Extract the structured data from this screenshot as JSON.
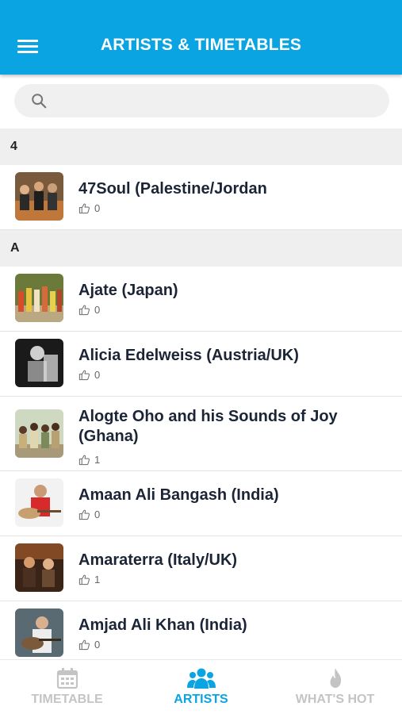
{
  "header": {
    "title": "ARTISTS & TIMETABLES",
    "menu_icon": "hamburger-menu-icon",
    "background": "#0aa4e3"
  },
  "search": {
    "placeholder": "",
    "value": "",
    "icon": "search-icon"
  },
  "sections": [
    {
      "letter": "4",
      "artists": [
        {
          "name": "47Soul (Palestine/Jordan",
          "likes": "0"
        }
      ]
    },
    {
      "letter": "A",
      "artists": [
        {
          "name": "Ajate (Japan)",
          "likes": "0"
        },
        {
          "name": "Alicia Edelweiss (Austria/UK)",
          "likes": "0"
        },
        {
          "name": "Alogte Oho and his Sounds of Joy (Ghana)",
          "likes": "1"
        },
        {
          "name": "Amaan Ali Bangash (India)",
          "likes": "0"
        },
        {
          "name": "Amaraterra (Italy/UK)",
          "likes": "1"
        },
        {
          "name": "Amjad Ali Khan (India)",
          "likes": "0"
        }
      ]
    }
  ],
  "tabs": [
    {
      "label": "TIMETABLE",
      "icon": "calendar-icon",
      "active": false
    },
    {
      "label": "ARTISTS",
      "icon": "group-icon",
      "active": true
    },
    {
      "label": "WHAT'S HOT",
      "icon": "flame-icon",
      "active": false
    }
  ],
  "colors": {
    "accent": "#0aa4e3",
    "inactive_tab": "#c4c4c4",
    "section_bg": "#efefef"
  }
}
